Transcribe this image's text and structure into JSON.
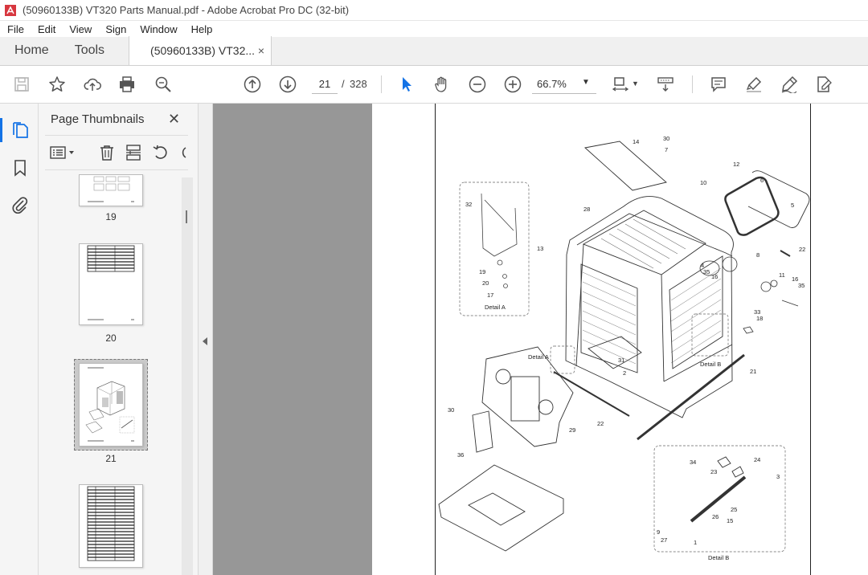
{
  "window": {
    "title": "(50960133B) VT320 Parts Manual.pdf - Adobe Acrobat Pro DC (32-bit)"
  },
  "menu": [
    "File",
    "Edit",
    "View",
    "Sign",
    "Window",
    "Help"
  ],
  "tabs": {
    "home": "Home",
    "tools": "Tools",
    "document": "(50960133B) VT32...",
    "close_glyph": "×"
  },
  "toolbar": {
    "current_page": "21",
    "page_separator": "/",
    "total_pages": "328",
    "zoom": "66.7%"
  },
  "panel": {
    "title": "Page Thumbnails",
    "thumbnails": [
      {
        "label": "19"
      },
      {
        "label": "20"
      },
      {
        "label": "21",
        "selected": true
      },
      {
        "label": ""
      }
    ]
  },
  "document": {
    "callouts": [
      "14",
      "30",
      "7",
      "12",
      "6",
      "5",
      "10",
      "28",
      "32",
      "22",
      "13",
      "8",
      "4",
      "35",
      "16",
      "11",
      "16",
      "35",
      "33",
      "19",
      "20",
      "17",
      "18",
      "31",
      "2",
      "21",
      "30",
      "29",
      "22",
      "36",
      "34",
      "24",
      "23",
      "3",
      "25",
      "26",
      "9",
      "27",
      "1",
      "15"
    ],
    "captions": {
      "detail_a_inset": "Detail A",
      "detail_a_pointer": "Detail A",
      "detail_b_pointer": "Detail B",
      "detail_b_inset": "Detail B"
    }
  },
  "colors": {
    "accent": "#1473e6",
    "app_red": "#d7373f",
    "doc_background": "#979797"
  }
}
